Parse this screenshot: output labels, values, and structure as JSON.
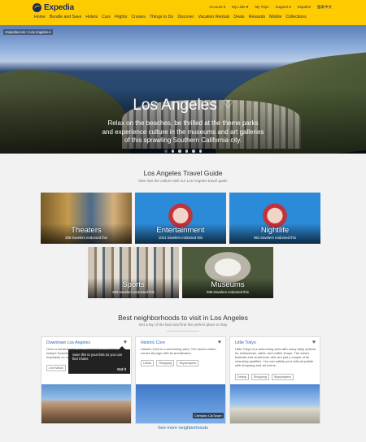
{
  "header": {
    "brand": "Expedia",
    "util_nav": [
      "Account ▾",
      "My Lists ♥",
      "My Trips",
      "Support ▾",
      "Español",
      "國泰中文"
    ],
    "main_nav": [
      "Home",
      "Bundle and Save",
      "Hotels",
      "Cars",
      "Flights",
      "Cruises",
      "Things to Do",
      "Discover",
      "Vacation Rentals",
      "Deals",
      "Rewards",
      "Mobile",
      "Collections"
    ],
    "accent": "#fecb00",
    "brand_color": "#1b2b5b"
  },
  "hero": {
    "breadcrumb": "Expedia.com > Los Angeles ▾",
    "title": "Los Angeles",
    "description": "Relax on the beaches, be thrilled at the theme parks and experience culture in the museums and art galleries of this sprawling Southern California city.",
    "carousel": {
      "total": 6,
      "active": 1
    }
  },
  "guide": {
    "title": "Los Angeles Travel Guide",
    "subtitle": "Dive into the culture with our Los Angeles travel guide",
    "cards": [
      {
        "label": "Theaters",
        "endorse": "309 travelers endorsed this"
      },
      {
        "label": "Entertainment",
        "endorse": "1021 travelers endorsed this"
      },
      {
        "label": "Nightlife",
        "endorse": "961 travelers endorsed this"
      },
      {
        "label": "Sports",
        "endorse": "264 travelers endorsed this"
      },
      {
        "label": "Museums",
        "endorse": "938 travelers endorsed this"
      }
    ]
  },
  "neighborhoods": {
    "title": "Best neighborhoods to visit in Los Angeles",
    "subtitle": "Get a lay of the land and find the perfect place to stay",
    "items": [
      {
        "name": "Downtown Los Angeles",
        "desc": "Once a hardscrabble area dominated by business, today's Downtown LA boasts a vibrant scene with an emphasis on culture.",
        "tags": [
          "Live Music"
        ]
      },
      {
        "name": "Historic Core",
        "desc": "Historic Core is a welcoming area. The area's charm comes through with its architecture.",
        "tags": [
          "Urban",
          "Shopping",
          "Skyscrapers"
        ]
      },
      {
        "name": "Little Tokyo",
        "desc": "Little Tokyo is a welcoming area with many tasty options for restaurants, cafés, and coffee shops. The area's festivals and small-town vibe are just a couple of its charming qualities. You can satisfy your cultural palate with shopping and art scene.",
        "tags": [
          "Dining",
          "Shopping",
          "Skyscrapers"
        ]
      }
    ],
    "tooltip": "Save this to your lists so you can find it later.",
    "tooltip_action": "Got it",
    "image_label": "Christian Ca/Tower",
    "see_more": "See more neighborhoods"
  }
}
